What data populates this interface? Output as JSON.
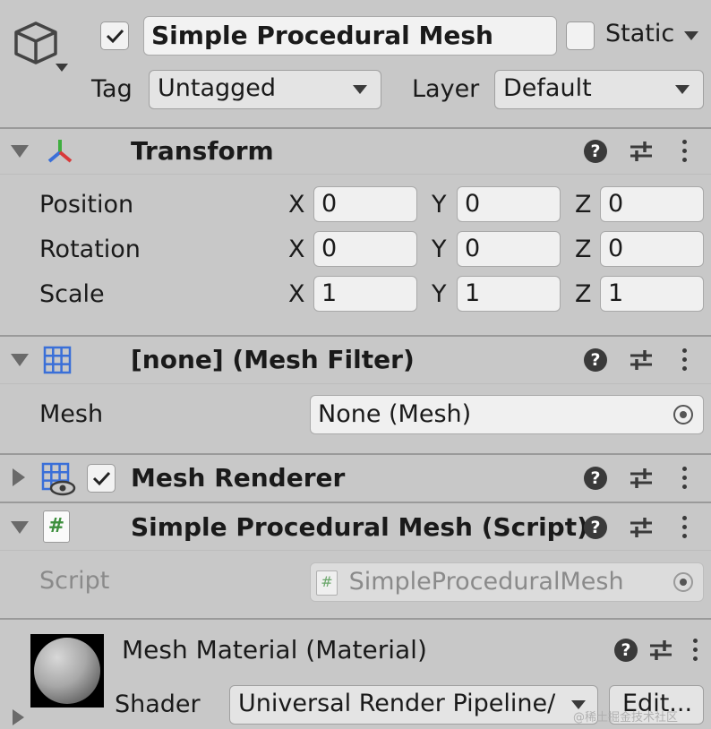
{
  "header": {
    "active_checked": true,
    "object_name": "Simple Procedural Mesh",
    "static_label": "Static",
    "static_checked": false,
    "tag_label": "Tag",
    "tag_value": "Untagged",
    "layer_label": "Layer",
    "layer_value": "Default"
  },
  "transform": {
    "title": "Transform",
    "rows": [
      {
        "label": "Position",
        "x": "0",
        "y": "0",
        "z": "0"
      },
      {
        "label": "Rotation",
        "x": "0",
        "y": "0",
        "z": "0"
      },
      {
        "label": "Scale",
        "x": "1",
        "y": "1",
        "z": "1"
      }
    ],
    "axis_labels": {
      "x": "X",
      "y": "Y",
      "z": "Z"
    }
  },
  "mesh_filter": {
    "title": "[none] (Mesh Filter)",
    "mesh_label": "Mesh",
    "mesh_value": "None (Mesh)"
  },
  "mesh_renderer": {
    "title": "Mesh Renderer",
    "enabled": true
  },
  "script_component": {
    "title": "Simple Procedural Mesh (Script)",
    "script_label": "Script",
    "script_value": "SimpleProceduralMesh",
    "script_icon_text": "#"
  },
  "material": {
    "title": "Mesh Material (Material)",
    "shader_label": "Shader",
    "shader_value": "Universal Render Pipeline/",
    "edit_label": "Edit..."
  },
  "icons": {
    "help": "?",
    "help_icon": "help-icon",
    "presets_icon": "presets-sliders-icon",
    "menu_icon": "kebab-menu-icon",
    "gameobject_icon": "cube-icon",
    "transform_icon": "transform-axes-icon",
    "mesh_filter_icon": "grid-icon",
    "mesh_renderer_icon": "grid-eye-icon",
    "script_icon": "script-hash-icon",
    "object_picker_icon": "target-icon"
  },
  "watermark": "@稀土掘金技术社区"
}
